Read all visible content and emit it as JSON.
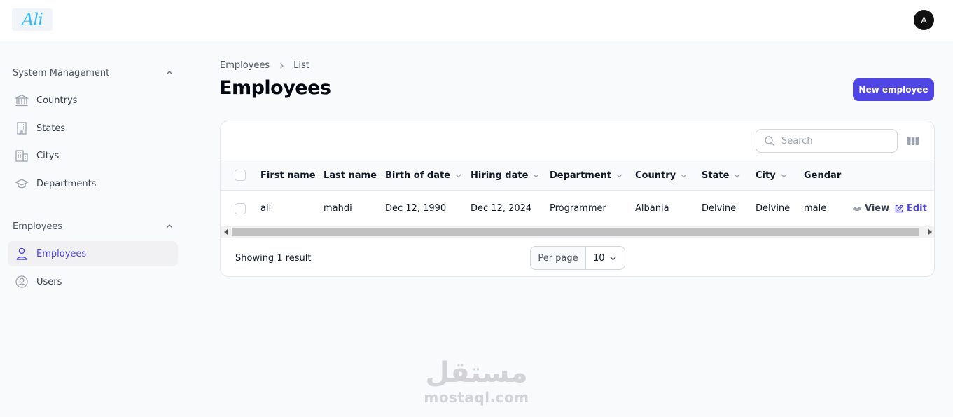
{
  "app": {
    "logo_text": "Ali",
    "avatar_initial": "A"
  },
  "sidebar": {
    "groups": [
      {
        "label": "System Management",
        "items": [
          {
            "label": "Countrys",
            "icon": "bank-icon"
          },
          {
            "label": "States",
            "icon": "building-icon"
          },
          {
            "label": "Citys",
            "icon": "office-building-icon"
          },
          {
            "label": "Departments",
            "icon": "academic-cap-icon"
          }
        ]
      },
      {
        "label": "Employees",
        "items": [
          {
            "label": "Employees",
            "icon": "user-icon",
            "active": true
          },
          {
            "label": "Users",
            "icon": "user-circle-icon"
          }
        ]
      }
    ]
  },
  "breadcrumb": [
    "Employees",
    "List"
  ],
  "page": {
    "title": "Employees",
    "new_button": "New employee"
  },
  "table": {
    "search_placeholder": "Search",
    "columns": [
      "First name",
      "Last name",
      "Birth of date",
      "Hiring date",
      "Department",
      "Country",
      "State",
      "City",
      "Gendar"
    ],
    "rows": [
      {
        "first_name": "ali",
        "last_name": "mahdi",
        "birth": "Dec 12, 1990",
        "hiring": "Dec 12, 2024",
        "department": "Programmer",
        "country": "Albania",
        "state": "Delvine",
        "city": "Delvine",
        "gender": "male"
      }
    ],
    "actions": {
      "view": "View",
      "edit": "Edit"
    },
    "footer": {
      "showing": "Showing 1 result",
      "per_page_label": "Per page",
      "per_page_value": "10"
    }
  },
  "colors": {
    "primary": "#4f46e5",
    "background": "#f9fafb"
  },
  "watermark": {
    "arabic": "مستقل",
    "latin": "mostaql.com"
  }
}
